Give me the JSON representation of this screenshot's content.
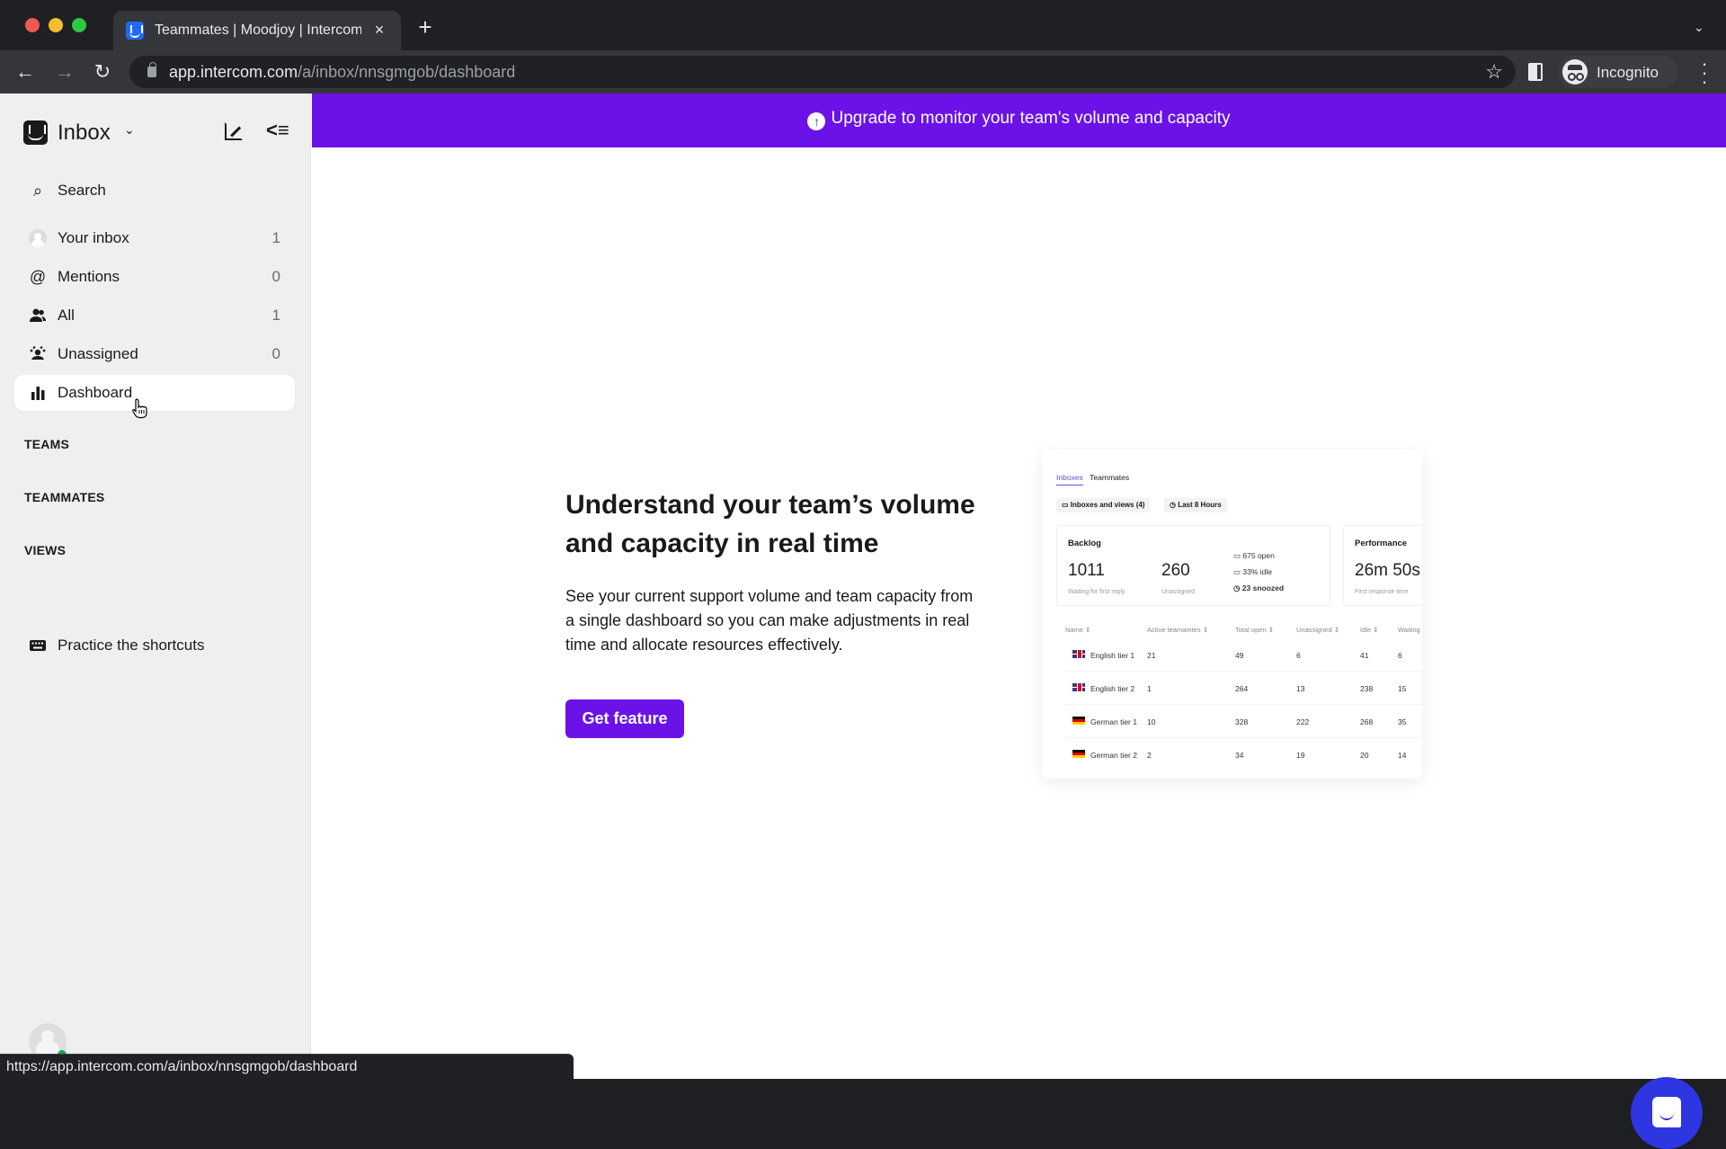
{
  "browser": {
    "tab_title": "Teammates | Moodjoy | Intercom",
    "tab_close_icon": "×",
    "new_tab_icon": "+",
    "tab_search_icon": "⌄",
    "back_icon": "←",
    "forward_icon": "→",
    "reload_icon": "↻",
    "url_host": "app.intercom.com",
    "url_path": "/a/inbox/nnsgmgob/dashboard",
    "bookmark_icon": "☆",
    "profile_label": "Incognito",
    "menu_icon": "⋮",
    "status_url": "https://app.intercom.com/a/inbox/nnsgmgob/dashboard"
  },
  "sidebar": {
    "title": "Inbox",
    "caret_icon": "⌄",
    "collapse_icon": "<≡",
    "search_label": "Search",
    "search_icon": "⌕",
    "items": [
      {
        "label": "Your inbox",
        "count": "1",
        "icon": "avatar"
      },
      {
        "label": "Mentions",
        "count": "0",
        "icon": "@"
      },
      {
        "label": "All",
        "count": "1",
        "icon": "👥"
      },
      {
        "label": "Unassigned",
        "count": "0",
        "icon": "☺"
      },
      {
        "label": "Dashboard",
        "count": "",
        "icon": "▮"
      }
    ],
    "sections": [
      "TEAMS",
      "TEAMMATES",
      "VIEWS"
    ],
    "shortcuts_label": "Practice the shortcuts",
    "shortcuts_icon": "⌨"
  },
  "banner": {
    "icon": "↑",
    "text": "Upgrade to monitor your team's volume and capacity",
    "color": "#6b12e8"
  },
  "promo": {
    "heading": "Understand your team’s volume and capacity in real time",
    "body": "See your current support volume and team capacity from a single dashboard so you can make adjustments in real time and allocate resources effectively.",
    "button_label": "Get feature"
  },
  "preview": {
    "tabs": [
      "Inboxes",
      "Teammates"
    ],
    "chips": [
      "Inboxes and views (4)",
      "Last 8 Hours"
    ],
    "backlog": {
      "title": "Backlog",
      "waiting": "1011",
      "waiting_label": "Waiting for first reply",
      "unassigned": "260",
      "unassigned_label": "Unassigned",
      "open": "675 open",
      "idle": "33% idle",
      "snoozed": "23 snoozed"
    },
    "performance": {
      "title": "Performance",
      "value": "26m 50s",
      "label": "First response time"
    },
    "columns": [
      "Name ⇕",
      "Active teamamtes ⇕",
      "Total open ⇕",
      "Unassigned ⇕",
      "Idle ⇕",
      "Waiting"
    ],
    "rows": [
      {
        "flag": "uk",
        "name": "English tier 1",
        "active": "21",
        "open": "49",
        "unassigned": "6",
        "idle": "41",
        "waiting": "6"
      },
      {
        "flag": "uk",
        "name": "English tier 2",
        "active": "1",
        "open": "264",
        "unassigned": "13",
        "idle": "238",
        "waiting": "15"
      },
      {
        "flag": "de",
        "name": "German tier 1",
        "active": "10",
        "open": "328",
        "unassigned": "222",
        "idle": "268",
        "waiting": "35"
      },
      {
        "flag": "de",
        "name": "German tier 2",
        "active": "2",
        "open": "34",
        "unassigned": "19",
        "idle": "20",
        "waiting": "14"
      }
    ]
  },
  "messenger": {
    "color": "#2d36e0"
  }
}
